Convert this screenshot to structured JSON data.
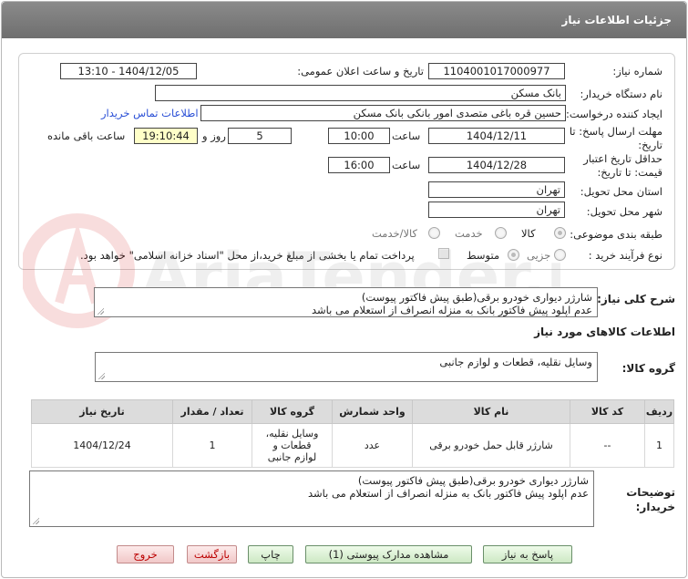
{
  "header": {
    "title": "جزئیات اطلاعات نیاز"
  },
  "form": {
    "need_number_label": "شماره نیاز:",
    "need_number": "1104001017000977",
    "announce_label": "تاریخ و ساعت اعلان عمومی:",
    "announce_value": "1404/12/05 - 13:10",
    "buyer_org_label": "نام دستگاه خریدار:",
    "buyer_org": "بانک مسکن",
    "creator_label": "ایجاد کننده درخواست:",
    "creator": "حسین  قره باغی متصدی امور بانکی بانک مسکن",
    "contact_link": "اطلاعات تماس خریدار",
    "deadline_label_1": "مهلت ارسال پاسخ: تا",
    "deadline_label_2": "تاریخ:",
    "deadline_date": "1404/12/11",
    "time_label": "ساعت",
    "deadline_time": "10:00",
    "days_value": "5",
    "days_label": "روز و",
    "remaining_time": "19:10:44",
    "remaining_label": "ساعت باقی مانده",
    "validity_label_1": "حداقل تاریخ اعتبار",
    "validity_label_2": "قیمت: تا تاریخ:",
    "validity_date": "1404/12/28",
    "validity_time": "16:00",
    "province_label": "استان محل تحویل:",
    "province": "تهران",
    "city_label": "شهر محل تحویل:",
    "city": "تهران",
    "category_label": "طبقه بندی موضوعی:",
    "category_options": [
      "کالا",
      "خدمت",
      "کالا/خدمت"
    ],
    "process_label": "نوع فرآیند خرید :",
    "process_options": [
      "جزیی",
      "متوسط"
    ],
    "payment_note": "پرداخت تمام یا بخشی از مبلغ خرید،از محل \"اسناد خزانه اسلامی\" خواهد بود."
  },
  "description": {
    "label": "شرح کلی نیاز:",
    "line1": "شارژر دیواری خودرو برقی(طبق پیش فاکتور پیوست)",
    "line2": "عدم اپلود پیش فاکتور بانک به منزله انصراف از استعلام می باشد"
  },
  "goods": {
    "section_title": "اطلاعات کالاهای مورد نیاز",
    "group_label": "گروه کالا:",
    "group_value": "وسایل نقلیه، قطعات و لوازم جانبی"
  },
  "table": {
    "headers": [
      "ردیف",
      "کد کالا",
      "نام کالا",
      "واحد شمارش",
      "گروه کالا",
      "تعداد / مقدار",
      "تاریخ نیاز"
    ],
    "rows": [
      {
        "row": "1",
        "code": "--",
        "name": "شارژر قابل حمل خودرو برقی",
        "unit": "عدد",
        "group": "وسایل نقلیه، قطعات و لوازم جانبی",
        "qty": "1",
        "date": "1404/12/24"
      }
    ]
  },
  "buyer_notes": {
    "label_1": "توضیحات",
    "label_2": "خریدار:",
    "line1": "شارژر دیواری خودرو برقی(طبق پیش فاکتور پیوست)",
    "line2": "عدم اپلود پیش فاکتور بانک به منزله انصراف از استعلام می باشد"
  },
  "buttons": {
    "respond": "پاسخ به نیاز",
    "view_docs": "مشاهده مدارک پیوستی (1)",
    "print": "چاپ",
    "back": "بازگشت",
    "exit": "خروج"
  },
  "watermark": "AriaTender.neT",
  "colors": {
    "title_bar": "#7d7d7d",
    "link": "#2a4fd6",
    "highlight": "#ffffc8",
    "exit_text": "#bb0000"
  }
}
